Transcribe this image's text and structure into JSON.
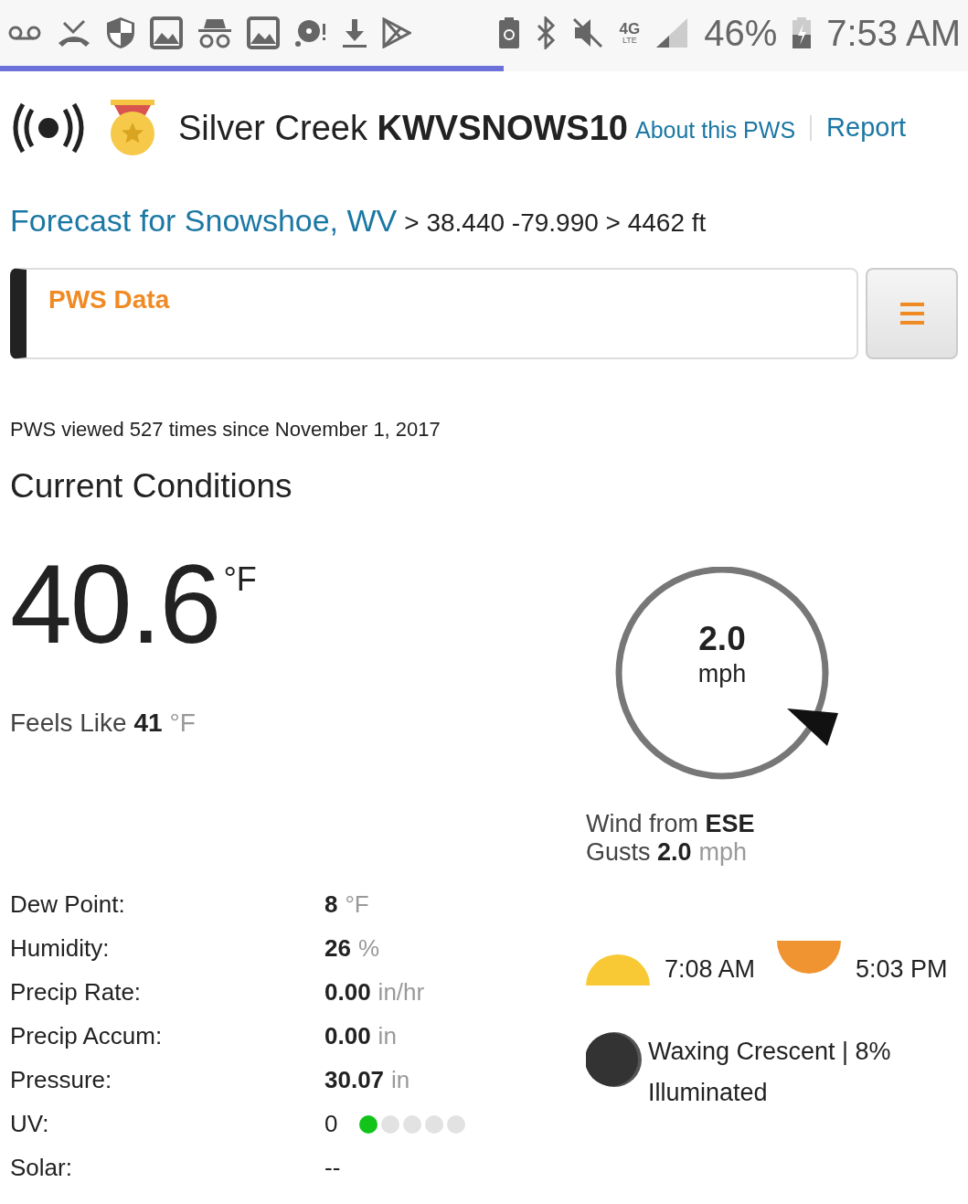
{
  "status_bar": {
    "network_type": "4G",
    "network_sub": "LTE",
    "battery": "46%",
    "time": "7:53 AM"
  },
  "load_progress": {
    "level": 0.52
  },
  "station": {
    "name": "Silver Creek",
    "id": "KWVSNOWS10",
    "about_link": "About this PWS",
    "report_link": "Report"
  },
  "location": {
    "forecast_link": "Forecast for Snowshoe, WV",
    "details": "> 38.440 -79.990 > 4462 ft"
  },
  "panel": {
    "title": "PWS Data"
  },
  "views_note": "PWS viewed 527 times since November 1, 2017",
  "section_title": "Current Conditions",
  "temperature": {
    "value": "40.6",
    "unit": "°F"
  },
  "feels_like": {
    "label": "Feels Like",
    "value": "41",
    "unit": "°F"
  },
  "wind": {
    "speed": "2.0",
    "unit": "mph",
    "from_label": "Wind from",
    "direction": "ESE",
    "gusts_label": "Gusts",
    "gusts": "2.0",
    "gusts_unit": "mph"
  },
  "observations": [
    {
      "kind": "measure",
      "label": "Dew Point:",
      "value": "8",
      "unit": "°F"
    },
    {
      "kind": "measure",
      "label": "Humidity:",
      "value": "26",
      "unit": "%"
    },
    {
      "kind": "measure",
      "label": "Precip Rate:",
      "value": "0.00",
      "unit": "in/hr"
    },
    {
      "kind": "measure",
      "label": "Precip Accum:",
      "value": "0.00",
      "unit": "in"
    },
    {
      "kind": "measure",
      "label": "Pressure:",
      "value": "30.07",
      "unit": "in"
    },
    {
      "kind": "uv",
      "label": "UV:",
      "value": "0",
      "uv_dots": [
        {
          "on": true
        },
        {
          "on": false
        },
        {
          "on": false
        },
        {
          "on": false
        },
        {
          "on": false
        }
      ]
    },
    {
      "kind": "plain",
      "label": "Solar:",
      "value": "--"
    }
  ],
  "sun": {
    "sunrise": "7:08 AM",
    "sunset": "5:03 PM"
  },
  "moon": {
    "phase": "Waxing Crescent | 8% Illuminated"
  }
}
